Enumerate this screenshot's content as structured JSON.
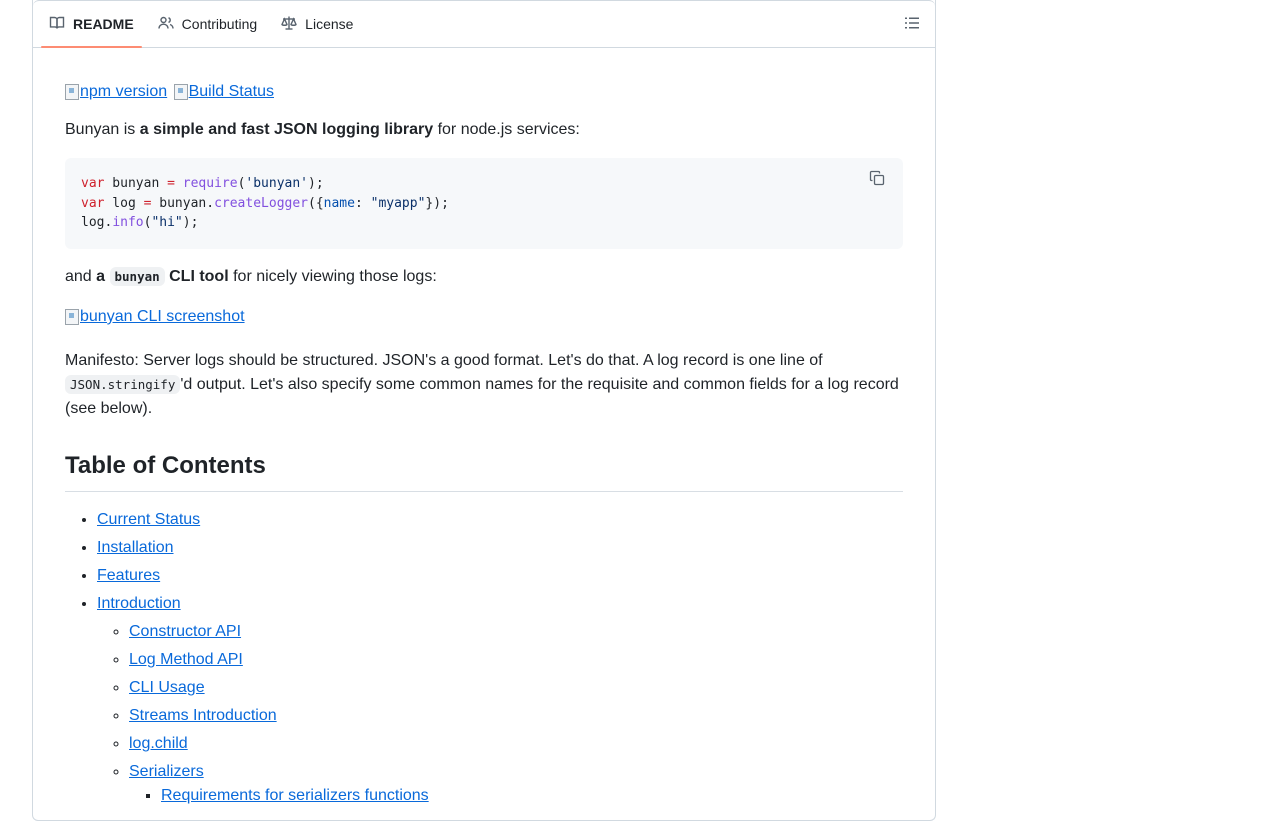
{
  "tabs": [
    {
      "label": "README",
      "icon": "book-icon"
    },
    {
      "label": "Contributing",
      "icon": "people-icon"
    },
    {
      "label": "License",
      "icon": "law-icon"
    }
  ],
  "badges": [
    "npm version",
    "Build Status"
  ],
  "intro": {
    "pre": "Bunyan is ",
    "bold": "a simple and fast JSON logging library",
    "post": " for node.js services:"
  },
  "code_lines": [
    "var bunyan = require('bunyan');",
    "var log = bunyan.createLogger({name: \"myapp\"});",
    "log.info(\"hi\");"
  ],
  "cli_line": {
    "pre": "and ",
    "bold_a": "a",
    "code": "bunyan",
    "bold_b": "CLI tool",
    "post": " for nicely viewing those logs:"
  },
  "screenshot_alt": "bunyan CLI screenshot",
  "manifesto": {
    "pre": "Manifesto: Server logs should be structured. JSON's a good format. Let's do that. A log record is one line of ",
    "code": "JSON.stringify",
    "post": "'d output. Let's also specify some common names for the requisite and common fields for a log record (see below)."
  },
  "toc_heading": "Table of Contents",
  "toc": {
    "top": [
      "Current Status",
      "Installation",
      "Features",
      "Introduction"
    ],
    "intro_children": [
      "Constructor API",
      "Log Method API",
      "CLI Usage",
      "Streams Introduction",
      "log.child",
      "Serializers"
    ],
    "serializer_children": [
      "Requirements for serializers functions"
    ]
  }
}
